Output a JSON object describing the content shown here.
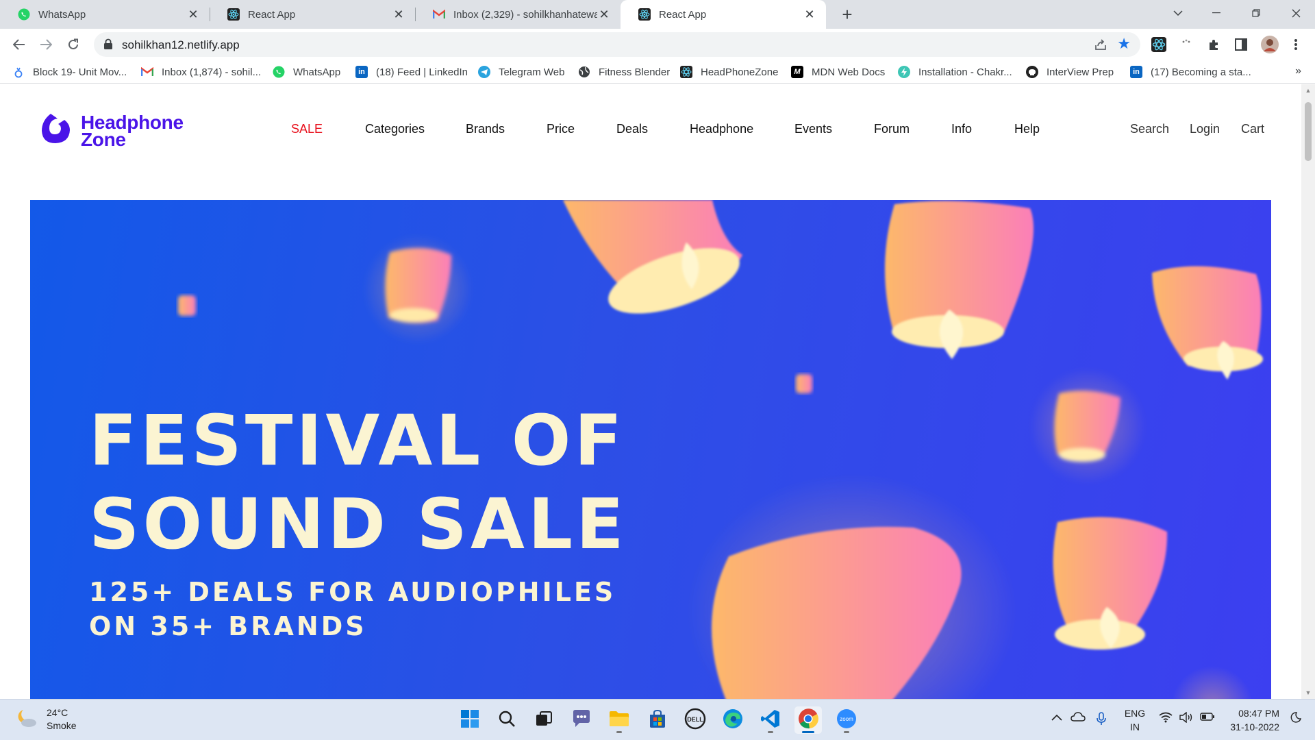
{
  "browser": {
    "tabs": [
      {
        "title": "WhatsApp",
        "icon": "whatsapp-icon",
        "active": false
      },
      {
        "title": "React App",
        "icon": "react-icon",
        "active": false
      },
      {
        "title": "Inbox (2,329) - sohilkhanhatewa",
        "icon": "gmail-icon",
        "active": false
      },
      {
        "title": "React App",
        "icon": "react-icon",
        "active": true
      }
    ],
    "url": "sohilkhan12.netlify.app",
    "bookmarks": [
      {
        "label": "Block 19- Unit Mov...",
        "icon": "masai-icon"
      },
      {
        "label": "Inbox (1,874) - sohil...",
        "icon": "gmail-icon"
      },
      {
        "label": "WhatsApp",
        "icon": "whatsapp-icon"
      },
      {
        "label": "(18) Feed | LinkedIn",
        "icon": "linkedin-icon"
      },
      {
        "label": "Telegram Web",
        "icon": "telegram-icon"
      },
      {
        "label": "Fitness Blender",
        "icon": "globe-icon"
      },
      {
        "label": "HeadPhoneZone",
        "icon": "react-icon"
      },
      {
        "label": "MDN Web Docs",
        "icon": "mdn-icon"
      },
      {
        "label": "Installation - Chakr...",
        "icon": "chakra-icon"
      },
      {
        "label": "InterView Prep",
        "icon": "github-icon"
      },
      {
        "label": "(17) Becoming a sta...",
        "icon": "linkedin-icon"
      }
    ],
    "more_bookmarks": "»"
  },
  "site": {
    "logo_line1": "Headphone",
    "logo_line2": "Zone",
    "nav": [
      "SALE",
      "Categories",
      "Brands",
      "Price",
      "Deals",
      "Headphone",
      "Events",
      "Forum",
      "Info",
      "Help"
    ],
    "utility": [
      "Search",
      "Login",
      "Cart"
    ],
    "banner": {
      "title_line1": "FESTIVAL OF",
      "title_line2": "SOUND SALE",
      "sub_line1": "125+ DEALS FOR AUDIOPHILES",
      "sub_line2": "ON 35+ BRANDS"
    }
  },
  "taskbar": {
    "weather_temp": "24°C",
    "weather_desc": "Smoke",
    "lang1": "ENG",
    "lang2": "IN",
    "time": "08:47 PM",
    "date": "31-10-2022"
  },
  "colors": {
    "brand": "#4a14e8",
    "sale": "#e8101c",
    "banner_blue": "#1359e8",
    "banner_text": "#fbf4d2"
  }
}
